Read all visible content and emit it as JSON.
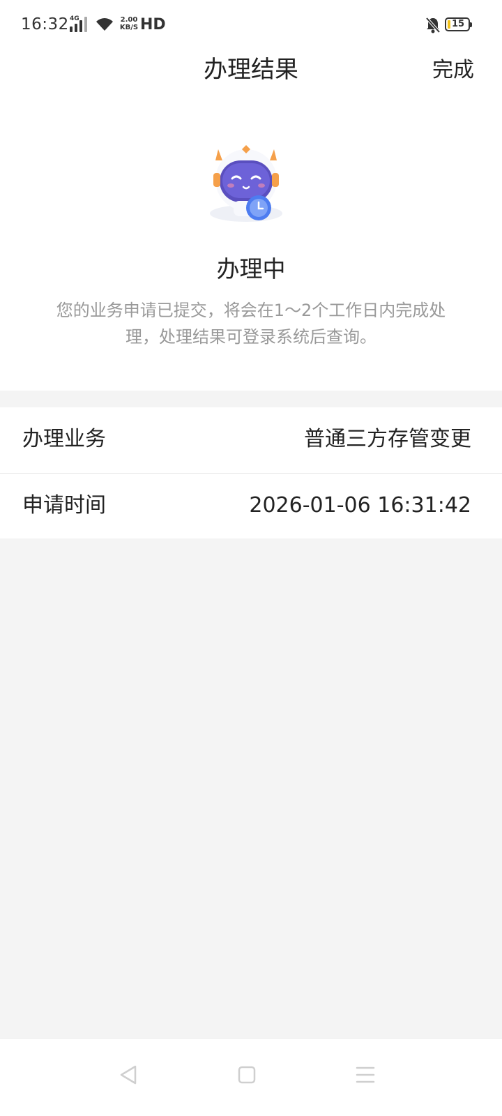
{
  "status_bar": {
    "time": "16:32",
    "network": "4G",
    "speed_value": "2.00",
    "speed_unit": "KB/S",
    "hd": "HD",
    "battery": "15",
    "battery_color": "#f2c21b"
  },
  "header": {
    "title": "办理结果",
    "done_label": "完成"
  },
  "result": {
    "mascot_icon": "robot-mascot-clock-icon",
    "status": "办理中",
    "description": "您的业务申请已提交，将会在1～2个工作日内完成处理，处理结果可登录系统后查询。"
  },
  "info": [
    {
      "label": "办理业务",
      "value": "普通三方存管变更"
    },
    {
      "label": "申请时间",
      "value": "2026-01-06 16:31:42"
    }
  ],
  "nav": {
    "back_icon": "back-triangle-icon",
    "home_icon": "home-square-icon",
    "menu_icon": "menu-lines-icon"
  },
  "colors": {
    "background": "#f4f4f4",
    "card": "#ffffff",
    "text": "#222222",
    "muted_text": "#999999"
  }
}
